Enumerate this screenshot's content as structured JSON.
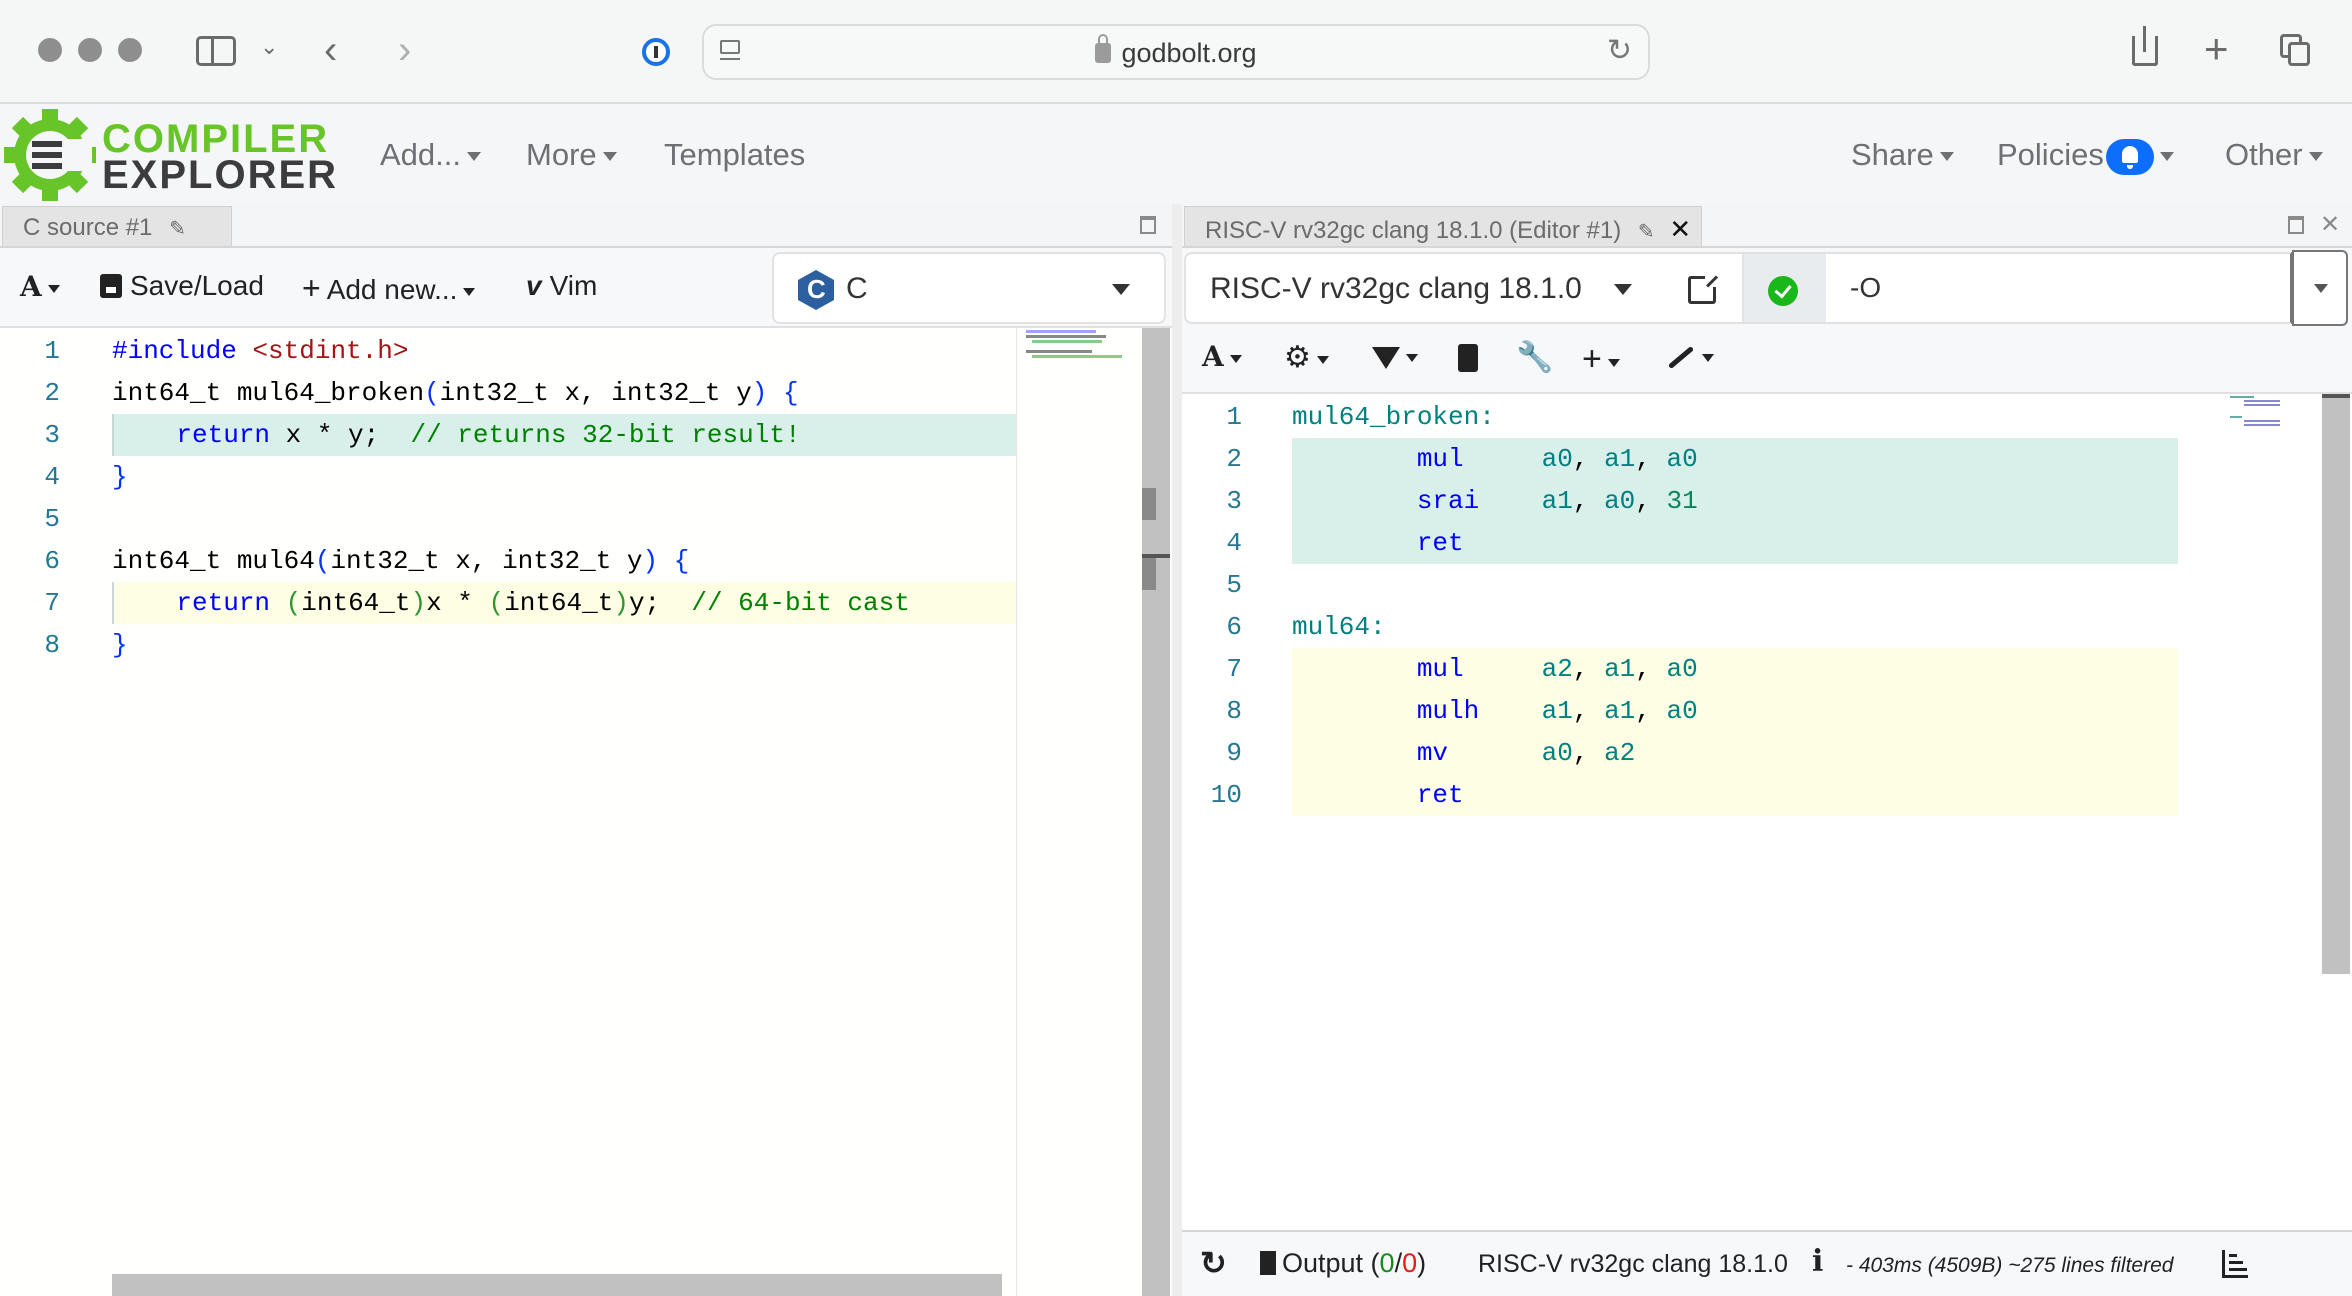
{
  "browser": {
    "url": "godbolt.org",
    "icons": [
      "window-close-dot",
      "window-minimize-dot",
      "window-zoom-dot",
      "sidebar-icon",
      "chevron-down-icon",
      "back-icon",
      "forward-icon",
      "password-manager-icon",
      "reader-icon",
      "lock-icon",
      "reload-icon",
      "share-icon",
      "new-tab-icon",
      "tabs-overview-icon"
    ]
  },
  "navbar": {
    "logo_line1": "COMPILER",
    "logo_line2": "EXPLORER",
    "add_label": "Add...",
    "more_label": "More",
    "templates_label": "Templates",
    "share_label": "Share",
    "policies_label": "Policies",
    "other_label": "Other"
  },
  "source_pane": {
    "tab_title": "C source #1",
    "toolbar": {
      "font_label": "A",
      "save_load_label": "Save/Load",
      "add_new_label": "Add new...",
      "vim_label": "Vim"
    },
    "language": "C",
    "lines": [
      {
        "num": "1",
        "parts": [
          [
            "kw",
            "#include "
          ],
          [
            "str",
            "<stdint.h>"
          ]
        ],
        "highlight": ""
      },
      {
        "num": "2",
        "parts": [
          [
            "",
            "int64_t mul64_broken"
          ],
          [
            "br",
            "("
          ],
          [
            "",
            "int32_t x, int32_t y"
          ],
          [
            "br",
            ")"
          ],
          [
            "",
            " "
          ],
          [
            "br",
            "{"
          ]
        ],
        "highlight": ""
      },
      {
        "num": "3",
        "parts": [
          [
            "",
            "    "
          ],
          [
            "kw",
            "return"
          ],
          [
            "",
            " x * y;  "
          ],
          [
            "cm",
            "// returns 32-bit result!"
          ]
        ],
        "highlight": "green"
      },
      {
        "num": "4",
        "parts": [
          [
            "br",
            "}"
          ]
        ],
        "highlight": ""
      },
      {
        "num": "5",
        "parts": [],
        "highlight": ""
      },
      {
        "num": "6",
        "parts": [
          [
            "",
            "int64_t mul64"
          ],
          [
            "br",
            "("
          ],
          [
            "",
            "int32_t x, int32_t y"
          ],
          [
            "br",
            ")"
          ],
          [
            "",
            " "
          ],
          [
            "br",
            "{"
          ]
        ],
        "highlight": ""
      },
      {
        "num": "7",
        "parts": [
          [
            "",
            "    "
          ],
          [
            "kw",
            "return"
          ],
          [
            "",
            " "
          ],
          [
            "br2",
            "("
          ],
          [
            "",
            "int64_t"
          ],
          [
            "br2",
            ")"
          ],
          [
            "",
            "x * "
          ],
          [
            "br2",
            "("
          ],
          [
            "",
            "int64_t"
          ],
          [
            "br2",
            ")"
          ],
          [
            "",
            "y;  "
          ],
          [
            "cm",
            "// 64-bit cast"
          ]
        ],
        "highlight": "yellow"
      },
      {
        "num": "8",
        "parts": [
          [
            "br",
            "}"
          ]
        ],
        "highlight": ""
      }
    ]
  },
  "compiler_pane": {
    "tab_title": "RISC-V rv32gc clang 18.1.0 (Editor #1)",
    "compiler_name": "RISC-V rv32gc clang 18.1.0",
    "options_value": "-O",
    "toolbar_icons": [
      "font-icon",
      "gear-icon",
      "filter-icon",
      "book-icon",
      "wrench-icon",
      "plus-icon",
      "brush-icon"
    ],
    "asm_lines": [
      {
        "num": "1",
        "label": "mul64_broken:",
        "op": "",
        "args": "",
        "highlight": ""
      },
      {
        "num": "2",
        "label": "",
        "op": "mul",
        "args": "a0, a1, a0",
        "highlight": "green"
      },
      {
        "num": "3",
        "label": "",
        "op": "srai",
        "args": "a1, a0, 31",
        "highlight": "green"
      },
      {
        "num": "4",
        "label": "",
        "op": "ret",
        "args": "",
        "highlight": "green"
      },
      {
        "num": "5",
        "label": "",
        "op": "",
        "args": "",
        "highlight": ""
      },
      {
        "num": "6",
        "label": "mul64:",
        "op": "",
        "args": "",
        "highlight": ""
      },
      {
        "num": "7",
        "label": "",
        "op": "mul",
        "args": "a2, a1, a0",
        "highlight": "yellow"
      },
      {
        "num": "8",
        "label": "",
        "op": "mulh",
        "args": "a1, a1, a0",
        "highlight": "yellow"
      },
      {
        "num": "9",
        "label": "",
        "op": "mv",
        "args": "a0, a2",
        "highlight": "yellow"
      },
      {
        "num": "10",
        "label": "",
        "op": "ret",
        "args": "",
        "highlight": "yellow"
      }
    ],
    "bottom": {
      "output_label": "Output (",
      "output_ok": "0",
      "output_sep": "/",
      "output_err": "0",
      "output_close": ")",
      "compiler_name": "RISC-V rv32gc clang 18.1.0",
      "info_icon": "i",
      "stats": "- 403ms (4509B) ~275 lines filtered"
    }
  },
  "colors": {
    "accent_green": "#67c52a",
    "status_ok": "#1ab71a",
    "badge_blue": "#0d6efd",
    "highlight_green": "#d9efea",
    "highlight_yellow": "#fefee5"
  }
}
